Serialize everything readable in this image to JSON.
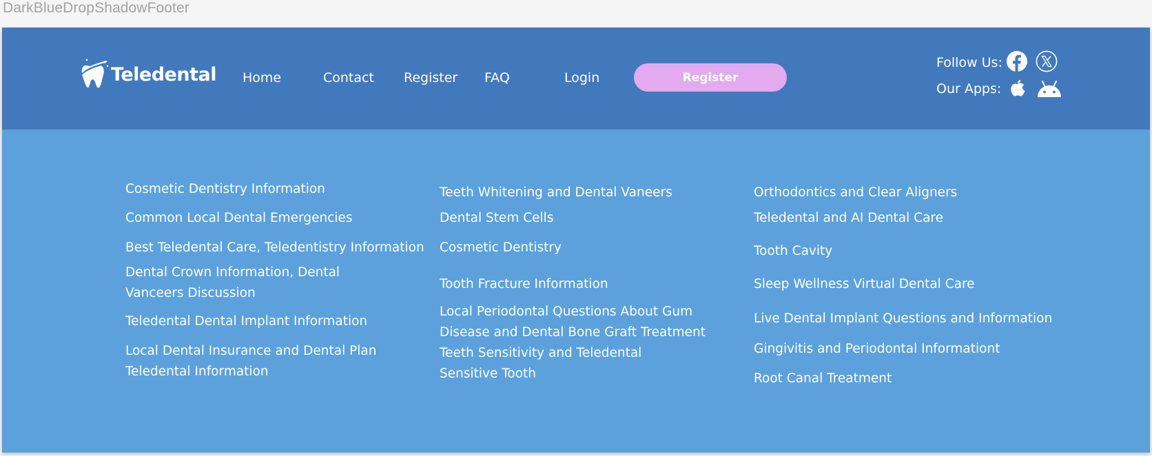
{
  "page_label": "DarkBlueDropShadowFooter",
  "brand": {
    "name": "Teledental"
  },
  "nav": {
    "home": "Home",
    "contact": "Contact",
    "register": "Register",
    "faq": "FAQ",
    "login": "Login",
    "cta_register": "Register"
  },
  "social": {
    "follow_label": "Follow Us:",
    "apps_label": "Our Apps:",
    "icons": [
      "facebook-icon",
      "x-twitter-icon",
      "apple-icon",
      "android-icon"
    ]
  },
  "links": {
    "col1": [
      "Cosmetic Dentistry Information",
      "Common Local Dental Emergencies",
      "Best Teledental Care, Teledentistry Information",
      "Dental Crown Information, Dental Vanceers Discussion",
      "Teledental Dental Implant Information",
      "Local Dental Insurance and Dental Plan Teledental Information"
    ],
    "col2": [
      "Teeth Whitening and Dental Vaneers",
      "Dental Stem Cells",
      "Cosmetic Dentistry",
      "Tooth Fracture Information",
      "Local Periodontal Questions About Gum Disease and Dental Bone Graft Treatment",
      "Teeth Sensitivity and Teledental Sensitive Tooth"
    ],
    "col3": [
      "Orthodontics and Clear Aligners",
      "Teledental and AI Dental Care",
      "Tooth Cavity",
      "Sleep Wellness Virtual Dental Care",
      "Live Dental Implant Questions and Information",
      "Gingivitis and Periodontal Informationt",
      "Root Canal Treatment"
    ]
  },
  "colors": {
    "top_bar": "#4279bd",
    "bottom_area": "#5ca1dc",
    "cta": "#e3aaf0",
    "text": "#ffffff"
  }
}
